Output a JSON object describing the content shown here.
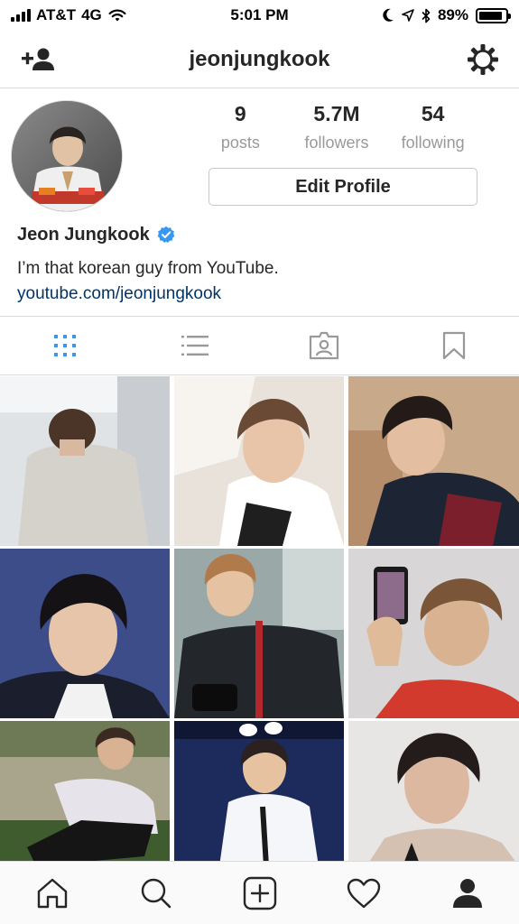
{
  "status_bar": {
    "carrier": "AT&T",
    "network": "4G",
    "time": "5:01 PM",
    "battery_percent": "89%",
    "battery_level": 0.89
  },
  "nav": {
    "title": "jeonjungkook",
    "left_icon": "add-person-icon",
    "right_icon": "settings-gear-icon"
  },
  "profile": {
    "stats": [
      {
        "value": "9",
        "label": "posts"
      },
      {
        "value": "5.7M",
        "label": "followers"
      },
      {
        "value": "54",
        "label": "following"
      }
    ],
    "edit_button_label": "Edit Profile",
    "display_name": "Jeon Jungkook",
    "verified": true,
    "bio": "I’m that korean guy from YouTube.",
    "link": "youtube.com/jeonjungkook"
  },
  "tabs": [
    {
      "icon": "grid-icon",
      "active": true
    },
    {
      "icon": "list-icon",
      "active": false
    },
    {
      "icon": "tagged-icon",
      "active": false
    },
    {
      "icon": "bookmark-icon",
      "active": false
    }
  ],
  "bottom_nav": [
    {
      "icon": "home-icon"
    },
    {
      "icon": "search-icon"
    },
    {
      "icon": "add-post-icon"
    },
    {
      "icon": "heart-icon"
    },
    {
      "icon": "profile-icon",
      "active": true
    }
  ],
  "colors": {
    "active_tab": "#3897f0",
    "inactive_icon": "#999999",
    "link": "#003569",
    "verified": "#3897f0",
    "border": "#dbdbdb"
  }
}
